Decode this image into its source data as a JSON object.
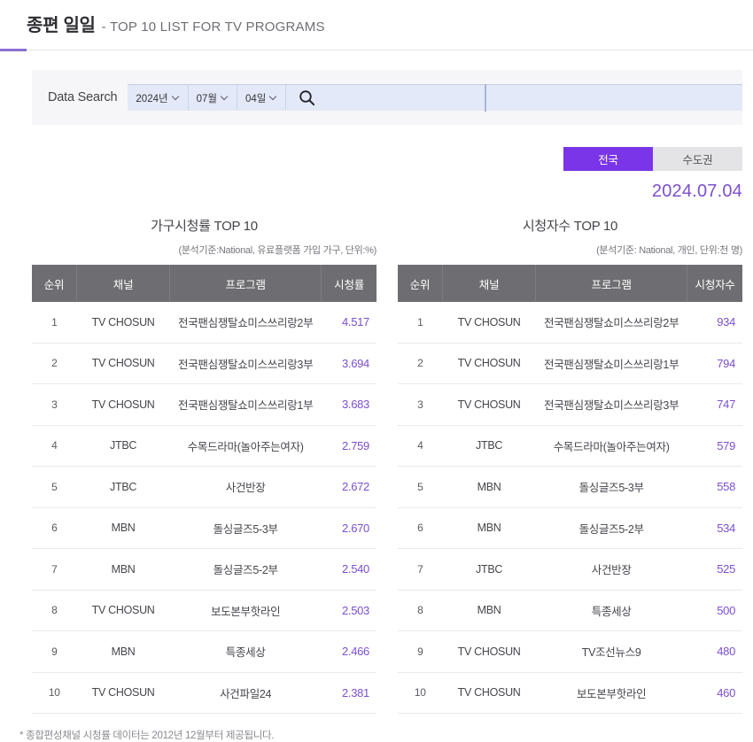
{
  "header": {
    "title_main": "종편 일일",
    "title_sub": "- TOP 10 LIST FOR TV PROGRAMS",
    "accent_color": "#8b6fd4"
  },
  "search": {
    "label": "Data Search",
    "year": "2024년",
    "month": "07월",
    "day": "04일",
    "search_icon": "search-icon",
    "chevron_icon": "chevron-down-icon"
  },
  "region_toggle": {
    "active_label": "전국",
    "inactive_label": "수도권",
    "active_color": "#7b35e8",
    "inactive_color": "#e4e4e6"
  },
  "date_display": "2024.07.04",
  "accent_value_color": "#7b4fd0",
  "tables": [
    {
      "title": "가구시청률 TOP 10",
      "note": "(분석기준:National, 유료플랫폼 가입 가구, 단위:%)",
      "columns": [
        "순위",
        "채널",
        "프로그램",
        "시청률"
      ],
      "rows": [
        {
          "rank": "1",
          "channel": "TV CHOSUN",
          "program": "전국팬심쟁탈쇼미스쓰리랑2부",
          "value": "4.517"
        },
        {
          "rank": "2",
          "channel": "TV CHOSUN",
          "program": "전국팬심쟁탈쇼미스쓰리랑3부",
          "value": "3.694"
        },
        {
          "rank": "3",
          "channel": "TV CHOSUN",
          "program": "전국팬심쟁탈쇼미스쓰리랑1부",
          "value": "3.683"
        },
        {
          "rank": "4",
          "channel": "JTBC",
          "program": "수목드라마(놀아주는여자)",
          "value": "2.759"
        },
        {
          "rank": "5",
          "channel": "JTBC",
          "program": "사건반장",
          "value": "2.672"
        },
        {
          "rank": "6",
          "channel": "MBN",
          "program": "돌싱글즈5-3부",
          "value": "2.670"
        },
        {
          "rank": "7",
          "channel": "MBN",
          "program": "돌싱글즈5-2부",
          "value": "2.540"
        },
        {
          "rank": "8",
          "channel": "TV CHOSUN",
          "program": "보도본부핫라인",
          "value": "2.503"
        },
        {
          "rank": "9",
          "channel": "MBN",
          "program": "특종세상",
          "value": "2.466"
        },
        {
          "rank": "10",
          "channel": "TV CHOSUN",
          "program": "사건파일24",
          "value": "2.381"
        }
      ]
    },
    {
      "title": "시청자수 TOP 10",
      "note": "(분석기준: National, 개인, 단위:천 명)",
      "columns": [
        "순위",
        "채널",
        "프로그램",
        "시청자수"
      ],
      "rows": [
        {
          "rank": "1",
          "channel": "TV CHOSUN",
          "program": "전국팬심쟁탈쇼미스쓰리랑2부",
          "value": "934"
        },
        {
          "rank": "2",
          "channel": "TV CHOSUN",
          "program": "전국팬심쟁탈쇼미스쓰리랑1부",
          "value": "794"
        },
        {
          "rank": "3",
          "channel": "TV CHOSUN",
          "program": "전국팬심쟁탈쇼미스쓰리랑3부",
          "value": "747"
        },
        {
          "rank": "4",
          "channel": "JTBC",
          "program": "수목드라마(놀아주는여자)",
          "value": "579"
        },
        {
          "rank": "5",
          "channel": "MBN",
          "program": "돌싱글즈5-3부",
          "value": "558"
        },
        {
          "rank": "6",
          "channel": "MBN",
          "program": "돌싱글즈5-2부",
          "value": "534"
        },
        {
          "rank": "7",
          "channel": "JTBC",
          "program": "사건반장",
          "value": "525"
        },
        {
          "rank": "8",
          "channel": "MBN",
          "program": "특종세상",
          "value": "500"
        },
        {
          "rank": "9",
          "channel": "TV CHOSUN",
          "program": "TV조선뉴스9",
          "value": "480"
        },
        {
          "rank": "10",
          "channel": "TV CHOSUN",
          "program": "보도본부핫라인",
          "value": "460"
        }
      ]
    }
  ],
  "footer_note": "* 종합편성채널 시청률 데이터는 2012년 12월부터 제공됩니다."
}
